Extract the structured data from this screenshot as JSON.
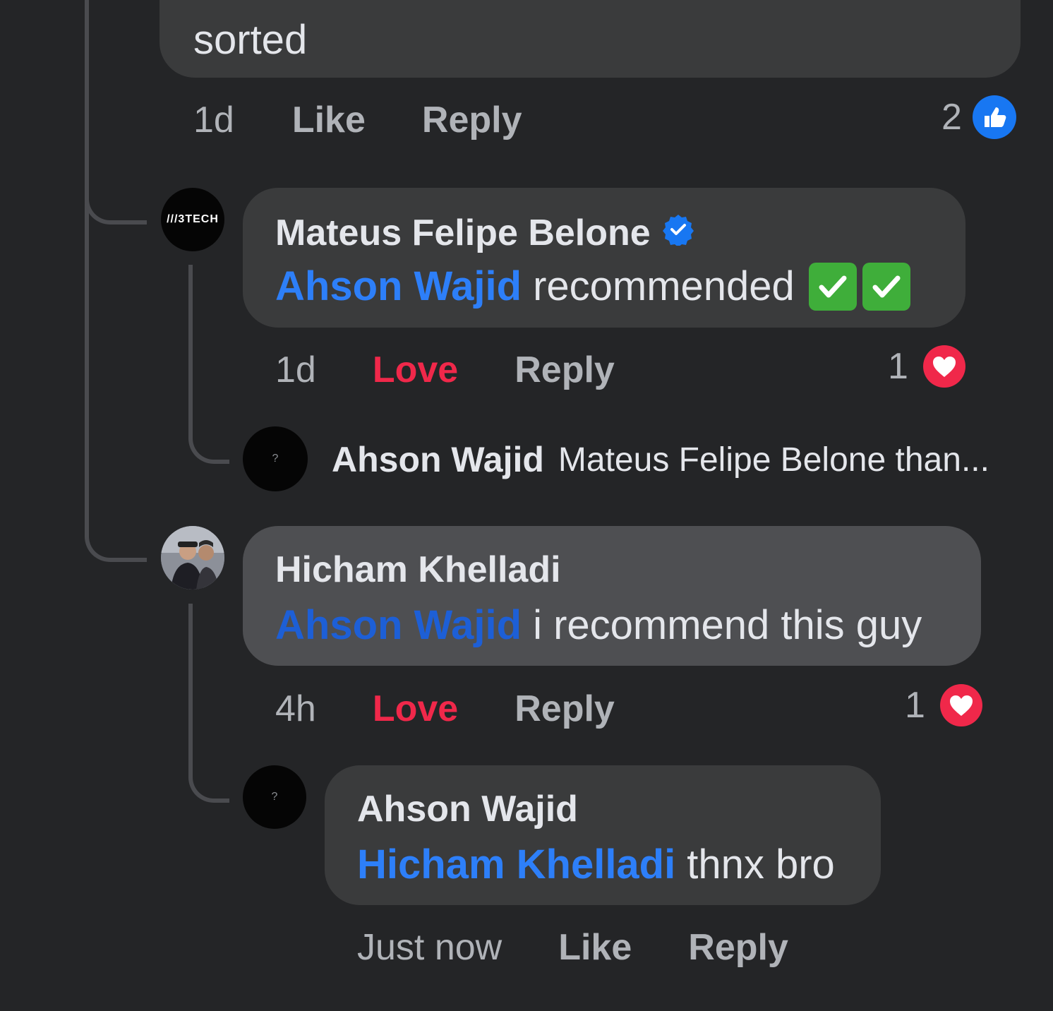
{
  "colors": {
    "background": "#242527",
    "bubble": "#3a3b3c",
    "bubble_highlight": "#4e4f52",
    "mention": "#2d7ff9",
    "love": "#f0284a",
    "meta_text": "#b0b3b8",
    "like_badge": "#1877f2",
    "heart_badge": "#f0284a",
    "check_emoji": "#3fae3a"
  },
  "comments": [
    {
      "id": "top",
      "text": "sorted",
      "time": "1d",
      "like_label": "Like",
      "reply_label": "Reply",
      "reaction_count": "2",
      "reaction_icon": "like-icon"
    },
    {
      "id": "mateus",
      "avatar_text": "///3TECH",
      "author": "Mateus Felipe Belone",
      "verified": true,
      "mention": "Ahson Wajid",
      "text": "recommended",
      "emoji": "check-mark-button-icon",
      "time": "1d",
      "love_label": "Love",
      "reply_label": "Reply",
      "reaction_count": "1",
      "reaction_icon": "heart-icon"
    },
    {
      "id": "ahson-collapsed",
      "avatar_text": "?",
      "author": "Ahson Wajid",
      "preview": "Mateus Felipe Belone than..."
    },
    {
      "id": "hicham",
      "author": "Hicham Khelladi",
      "mention": "Ahson Wajid",
      "text": "i recommend this guy",
      "time": "4h",
      "love_label": "Love",
      "reply_label": "Reply",
      "reaction_count": "1",
      "reaction_icon": "heart-icon"
    },
    {
      "id": "ahson-reply",
      "avatar_text": "?",
      "author": "Ahson Wajid",
      "mention": "Hicham Khelladi",
      "text": "thnx bro",
      "time": "Just now",
      "like_label": "Like",
      "reply_label": "Reply"
    }
  ]
}
